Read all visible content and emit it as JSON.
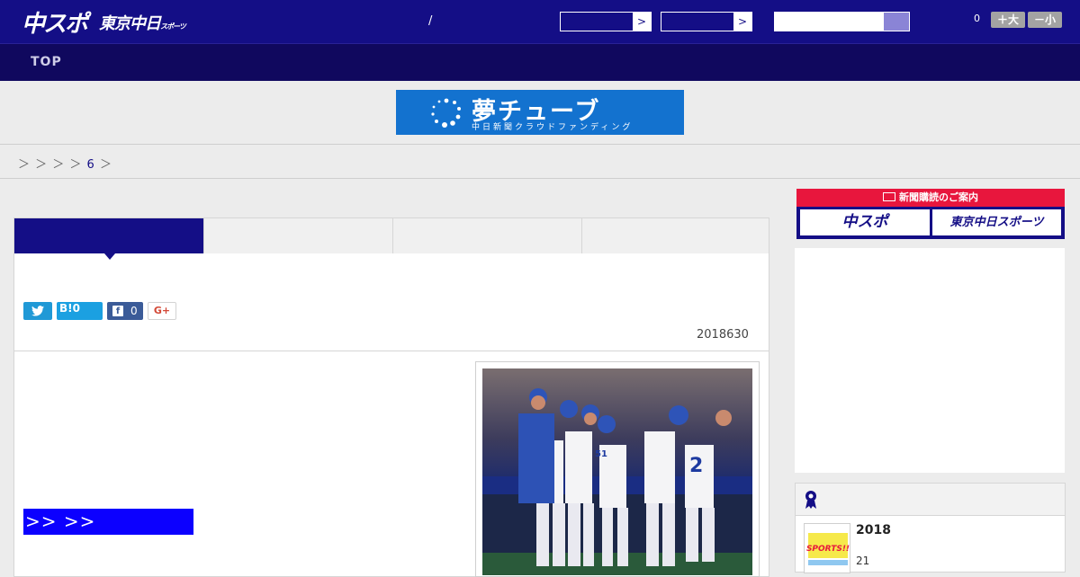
{
  "header": {
    "logo_primary": "中スポ",
    "logo_secondary": "東京中日",
    "logo_secondary_small": "スポーツ",
    "separator": "/",
    "select_arrow": ">",
    "font_count": "0",
    "font_larger": "＋大",
    "font_smaller": "－小"
  },
  "nav": {
    "top_label": "TOP"
  },
  "banner": {
    "title": "夢チューブ",
    "subtitle": "中日新聞クラウドファンディング"
  },
  "breadcrumb": {
    "sep1": "＞ ＞ ＞ ＞",
    "current": "6",
    "sep2": "＞"
  },
  "share": {
    "twitter_icon": "twitter-bird",
    "hatena_label": "B!",
    "hatena_count": "0",
    "facebook_icon": "f",
    "facebook_count": "0",
    "gplus_label": "G+"
  },
  "article": {
    "date": "2018630",
    "more_link": ">> >>"
  },
  "sidebar": {
    "subscribe_head": "新聞購読のご案内",
    "subscribe_logo1": "中スポ",
    "subscribe_logo2": "東京中日スポーツ",
    "rank_title": "2018",
    "rank_sub": "21",
    "thumb_label": "SPORTS!!"
  },
  "colors": {
    "header_bg": "#140e86",
    "nav_bg": "#10085e",
    "banner_bg": "#1372cf",
    "link_block": "#0c00ff",
    "subscribe_red": "#e8163d"
  }
}
